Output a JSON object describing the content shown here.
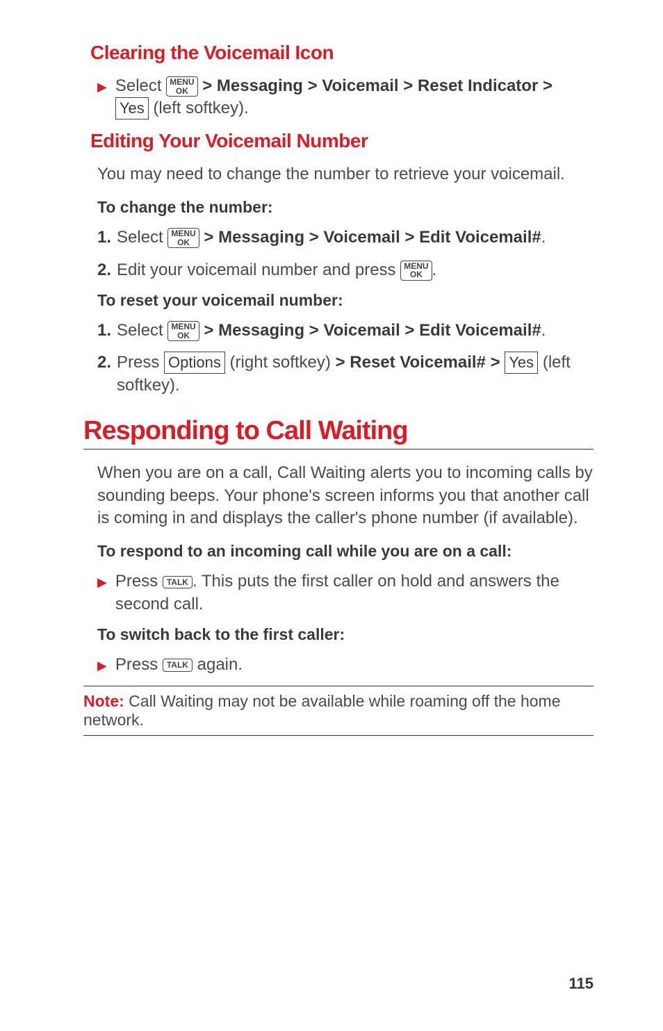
{
  "section1": {
    "heading": "Clearing the Voicemail Icon",
    "bullet": {
      "pre": "Select ",
      "key": "MENU\nOK",
      "nav": " > Messaging > Voicemail > Reset Indicator > ",
      "box": "Yes",
      "post": " (left softkey)."
    }
  },
  "section2": {
    "heading": "Editing Your Voicemail Number",
    "intro": "You may need to change the number to retrieve your voicemail.",
    "sub1": "To change the number:",
    "step1": {
      "num": "1.",
      "pre": "Select ",
      "key": "MENU\nOK",
      "nav": " > Messaging > Voicemail > Edit Voicemail#",
      "post": "."
    },
    "step2": {
      "num": "2.",
      "pre": "Edit your voicemail number and press ",
      "key": "MENU\nOK",
      "post": "."
    },
    "sub2": "To reset your voicemail number:",
    "step3": {
      "num": "1.",
      "pre": "Select ",
      "key": "MENU\nOK",
      "nav": " > Messaging > Voicemail > Edit Voicemail#",
      "post": "."
    },
    "step4": {
      "num": "2.",
      "pre": "Press ",
      "box1": "Options",
      "mid1": " (right softkey) ",
      "nav": "> Reset Voicemail# >",
      "box2": "Yes",
      "post": " (left softkey)."
    }
  },
  "section3": {
    "heading": "Responding to Call Waiting",
    "intro": "When you are on a call, Call Waiting alerts you to incoming calls by sounding beeps. Your phone's screen informs you that another call is coming in and displays the caller's phone number (if available).",
    "sub1": "To respond to an incoming call while you are on a call:",
    "bullet1": {
      "pre": "Press ",
      "key": "TALK",
      "post": ". This puts the first caller on hold and answers the second call."
    },
    "sub2": "To switch back to the first caller:",
    "bullet2": {
      "pre": "Press ",
      "key": "TALK",
      "post": " again."
    }
  },
  "note": {
    "label": "Note:",
    "text": " Call Waiting may not be available while roaming off the home network."
  },
  "pageNumber": "115"
}
